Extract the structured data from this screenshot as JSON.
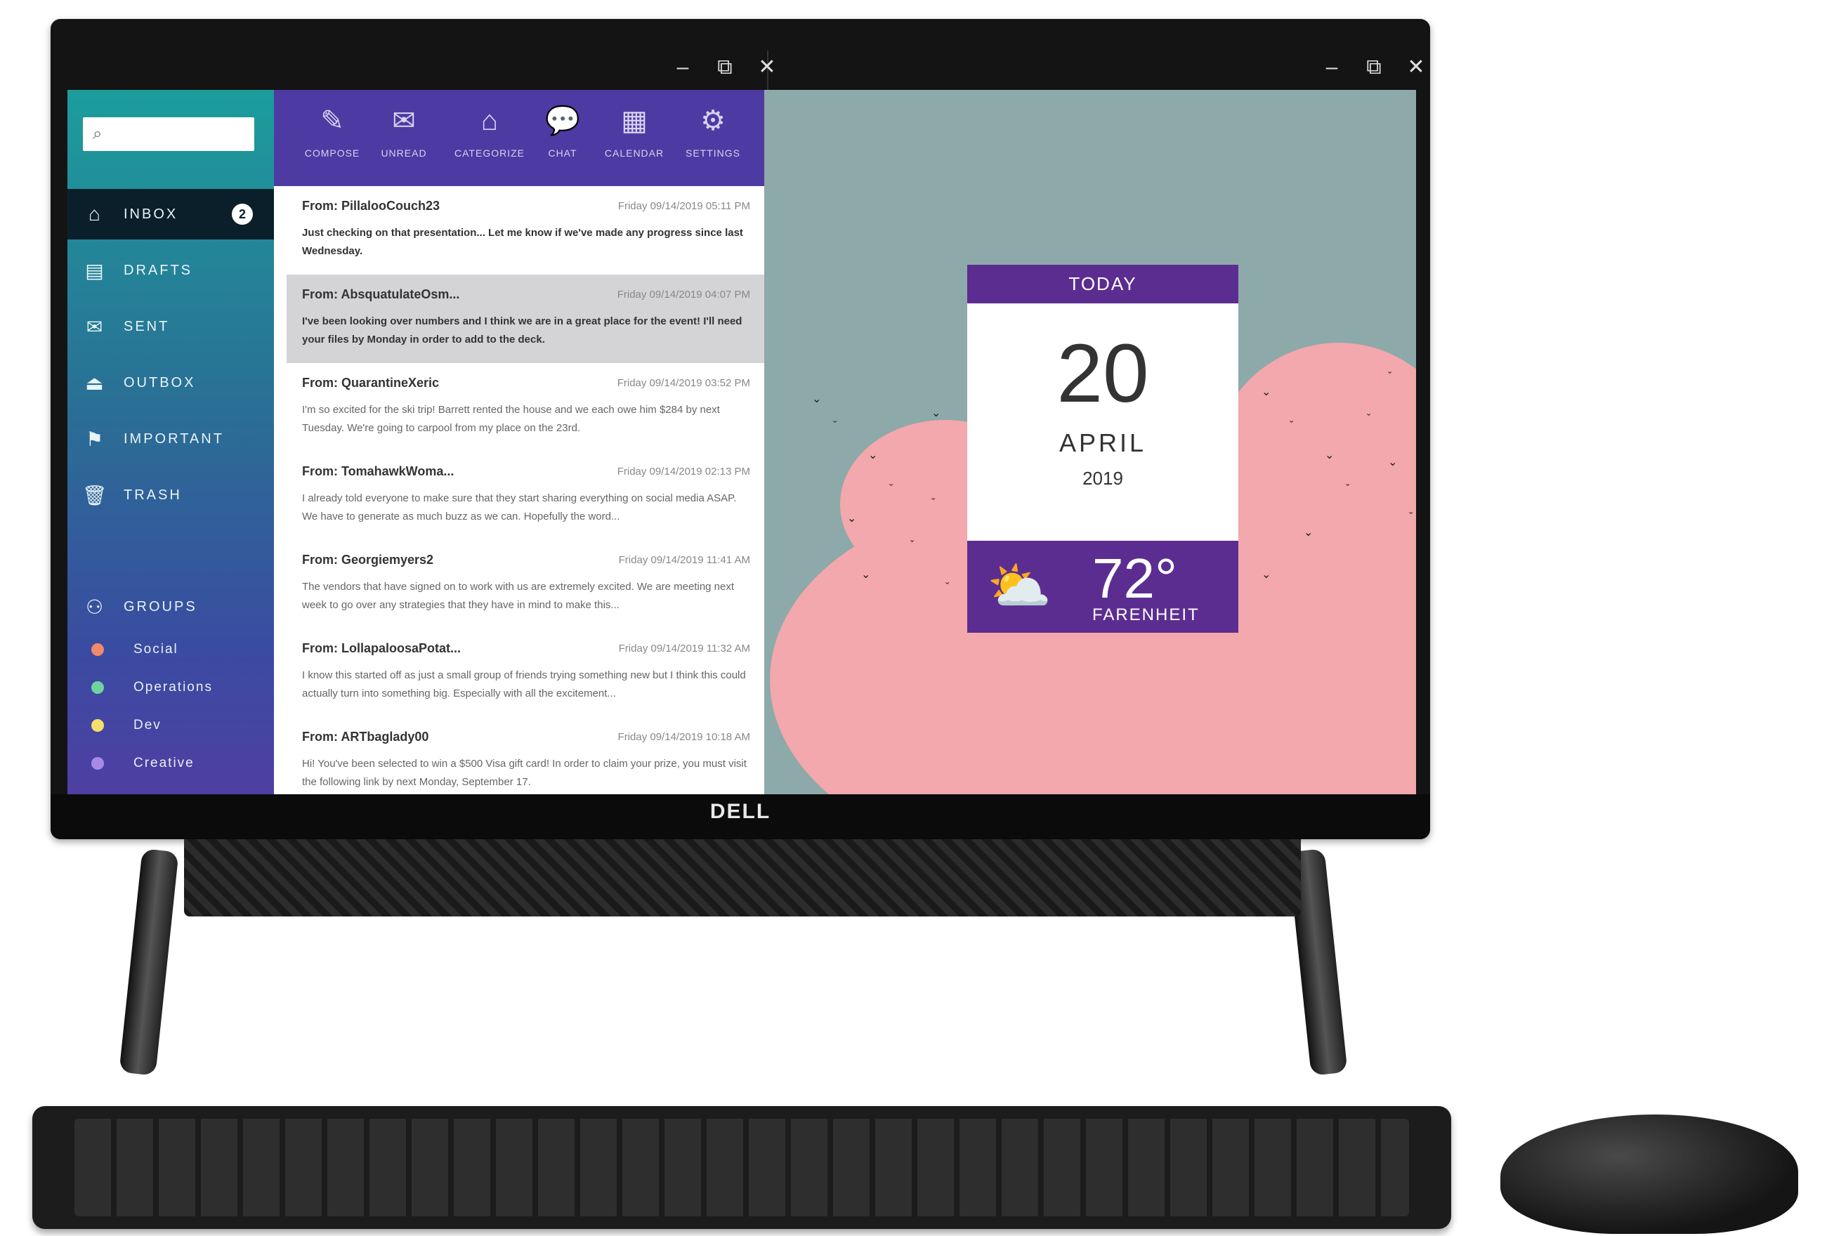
{
  "brand": "DELL",
  "window_controls": {
    "minimize": "–",
    "restore": "⧉",
    "close": "✕"
  },
  "sidebar": {
    "search_placeholder": "",
    "nav": [
      {
        "label": "INBOX",
        "icon": "inbox-tray-icon",
        "badge": "2",
        "active": true
      },
      {
        "label": "DRAFTS",
        "icon": "draft-document-icon"
      },
      {
        "label": "SENT",
        "icon": "envelope-sent-icon"
      },
      {
        "label": "OUTBOX",
        "icon": "outbox-tray-icon"
      },
      {
        "label": "IMPORTANT",
        "icon": "flag-icon"
      },
      {
        "label": "TRASH",
        "icon": "trash-can-icon"
      }
    ],
    "groups_label": "GROUPS",
    "groups": [
      {
        "label": "Social",
        "color": "#f08a6a"
      },
      {
        "label": "Operations",
        "color": "#6fd3a0"
      },
      {
        "label": "Dev",
        "color": "#f3e06a"
      },
      {
        "label": "Creative",
        "color": "#a88ae6"
      }
    ]
  },
  "toolbar": [
    {
      "label": "COMPOSE",
      "icon": "pencil-icon"
    },
    {
      "label": "UNREAD",
      "icon": "envelope-icon"
    },
    {
      "label": "CATEGORIZE",
      "icon": "tag-icon"
    },
    {
      "label": "CHAT",
      "icon": "chat-bubble-icon"
    },
    {
      "label": "CALENDAR",
      "icon": "calendar-icon"
    },
    {
      "label": "SETTINGS",
      "icon": "gear-icon"
    }
  ],
  "emails": [
    {
      "from": "From: PillalooCouch23",
      "date": "Friday 09/14/2019 05:11 PM",
      "body": "Just checking on that presentation... Let me know if we've made any progress since last Wednesday."
    },
    {
      "from": "From: AbsquatulateOsm...",
      "date": "Friday 09/14/2019 04:07 PM",
      "body": "I've been looking over numbers and I think we are in a great place for the event! I'll need your files by Monday in order to add to the deck."
    },
    {
      "from": "From: QuarantineXeric",
      "date": "Friday 09/14/2019 03:52 PM",
      "body": "I'm so excited for the ski trip! Barrett rented the house and we each owe him $284 by next Tuesday. We're going to carpool from my place on the 23rd."
    },
    {
      "from": "From: TomahawkWoma...",
      "date": "Friday 09/14/2019 02:13 PM",
      "body": "I already told everyone to make sure that they start sharing everything on social media ASAP. We have to generate as much buzz as we can. Hopefully the word..."
    },
    {
      "from": "From: Georgiemyers2",
      "date": "Friday 09/14/2019 11:41 AM",
      "body": "The vendors that have signed on to work with us are extremely excited. We are meeting next week to go over any strategies that they have in mind to make this..."
    },
    {
      "from": "From: LollapaloosaPotat...",
      "date": "Friday 09/14/2019 11:32 AM",
      "body": "I know this started off as just a small group of friends trying something new but I think this could actually turn into something big. Especially with all the excitement..."
    },
    {
      "from": "From: ARTbaglady00",
      "date": "Friday 09/14/2019 10:18 AM",
      "body": "Hi! You've been selected to win a $500 Visa gift card! In order to claim your prize, you must visit the following link by next Monday, September 17."
    }
  ],
  "widget": {
    "header": "TODAY",
    "day": "20",
    "month": "APRIL",
    "year": "2019",
    "weather_icon": "partly-cloudy-icon",
    "temperature": "72°",
    "unit": "FARENHEIT"
  },
  "colors": {
    "accent_purple": "#5c2d91",
    "toolbar_purple": "#4e3aa3"
  }
}
